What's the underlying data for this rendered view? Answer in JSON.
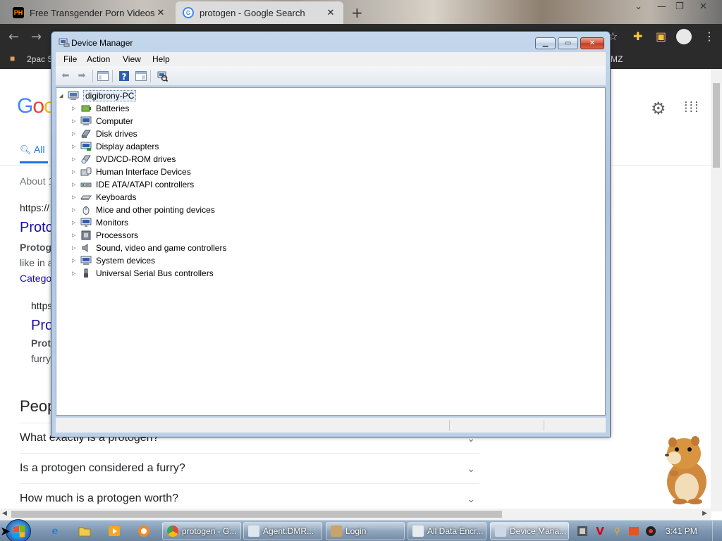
{
  "browser": {
    "tabs": [
      {
        "title": "Free Transgender Porn Videos a",
        "favicon": "PH",
        "active": false
      },
      {
        "title": "protogen - Google Search",
        "favicon": "G",
        "active": true
      }
    ],
    "bookmark_partial": "2pac S",
    "bookmark_right": "MZ"
  },
  "google": {
    "logo_partial": "Goo",
    "tab_all": "All",
    "about_partial": "About 1",
    "url1": "https://",
    "title1_partial": "Proto",
    "snippet1_bold": "Protog",
    "snippet1": "like in a",
    "category_partial": "Catego",
    "url2": "https",
    "title2_partial": "Pro",
    "snippet2_bold": "Prot",
    "snippet2": "furry",
    "people_partial": "Peop",
    "questions": [
      "What exactly is a protogen?",
      "Is a protogen considered a furry?",
      "How much is a protogen worth?"
    ]
  },
  "device_manager": {
    "title": "Device Manager",
    "menu": [
      "File",
      "Action",
      "View",
      "Help"
    ],
    "root": "digibrony-PC",
    "categories": [
      {
        "label": "Batteries",
        "icon": "battery-icon"
      },
      {
        "label": "Computer",
        "icon": "computer-icon"
      },
      {
        "label": "Disk drives",
        "icon": "disk-drive-icon"
      },
      {
        "label": "Display adapters",
        "icon": "display-adapter-icon"
      },
      {
        "label": "DVD/CD-ROM drives",
        "icon": "dvd-drive-icon"
      },
      {
        "label": "Human Interface Devices",
        "icon": "hid-icon"
      },
      {
        "label": "IDE ATA/ATAPI controllers",
        "icon": "ide-controller-icon"
      },
      {
        "label": "Keyboards",
        "icon": "keyboard-icon"
      },
      {
        "label": "Mice and other pointing devices",
        "icon": "mouse-icon"
      },
      {
        "label": "Monitors",
        "icon": "monitor-icon"
      },
      {
        "label": "Processors",
        "icon": "processor-icon"
      },
      {
        "label": "Sound, video and game controllers",
        "icon": "speaker-icon"
      },
      {
        "label": "System devices",
        "icon": "system-device-icon"
      },
      {
        "label": "Universal Serial Bus controllers",
        "icon": "usb-icon"
      }
    ]
  },
  "taskbar": {
    "windows": [
      {
        "label": "protogen - G...",
        "icon": "chrome-icon"
      },
      {
        "label": "Agent.DMR...",
        "icon": "app-window-icon"
      },
      {
        "label": "Login",
        "icon": "login-app-icon"
      },
      {
        "label": "All Data Encr...",
        "icon": "encryption-app-icon"
      },
      {
        "label": "Device Mana...",
        "icon": "device-manager-icon",
        "active": true
      }
    ],
    "clock": "3:41 PM"
  },
  "colors": {
    "google_blue": "#1a73e8",
    "link": "#1a0dab",
    "win7_titlebar": "#a9c4e2",
    "close_red": "#c23a20"
  }
}
